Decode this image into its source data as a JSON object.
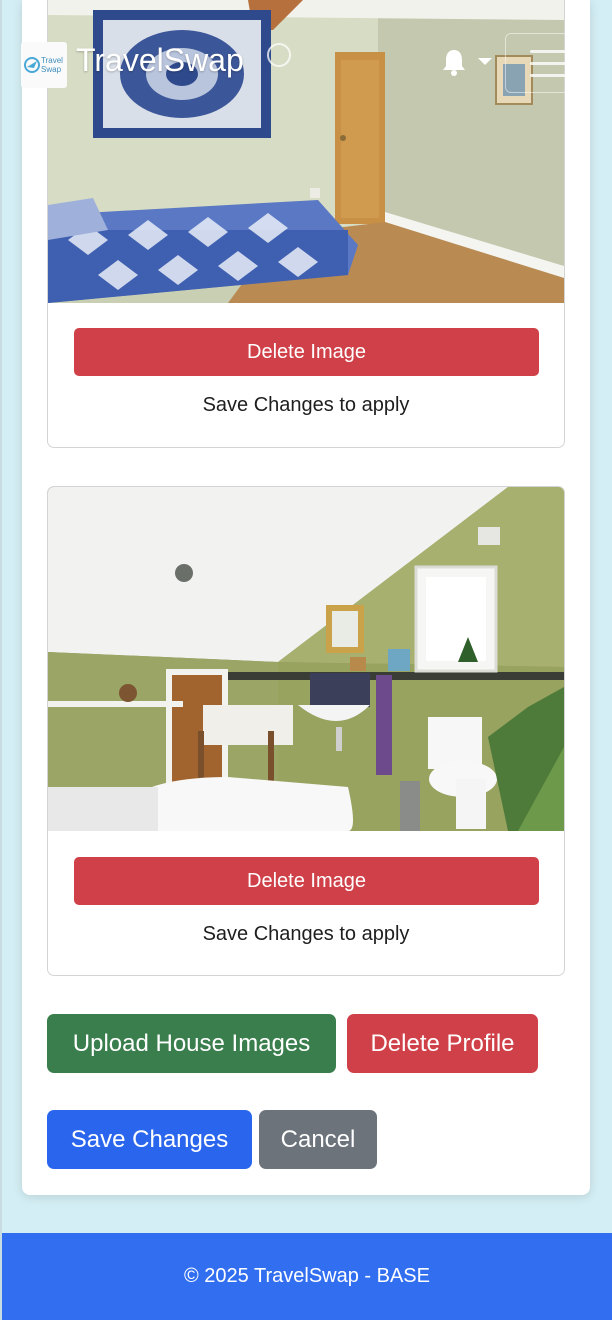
{
  "navbar": {
    "brand": "TravelSwap",
    "logo_text_line1": "Travel",
    "logo_text_line2": "Swap",
    "icons": [
      "logo-icon",
      "theme-toggle-icon",
      "bell-icon",
      "chevron-down-icon",
      "hamburger-menu-icon"
    ]
  },
  "house_images": [
    {
      "photo": "bedroom-photo",
      "delete_label": "Delete Image",
      "note": "Save Changes to apply"
    },
    {
      "photo": "bathroom-photo",
      "delete_label": "Delete Image",
      "note": "Save Changes to apply"
    }
  ],
  "actions": {
    "upload_label": "Upload House Images",
    "delete_profile_label": "Delete Profile",
    "save_label": "Save Changes",
    "cancel_label": "Cancel"
  },
  "footer": {
    "text": "© 2025 TravelSwap - BASE"
  },
  "colors": {
    "page_bg": "#d3eef4",
    "danger": "#cf4048",
    "success": "#3a7e4d",
    "primary": "#2a66ed",
    "secondary": "#6c737a",
    "footer_bg": "#326ff0"
  }
}
